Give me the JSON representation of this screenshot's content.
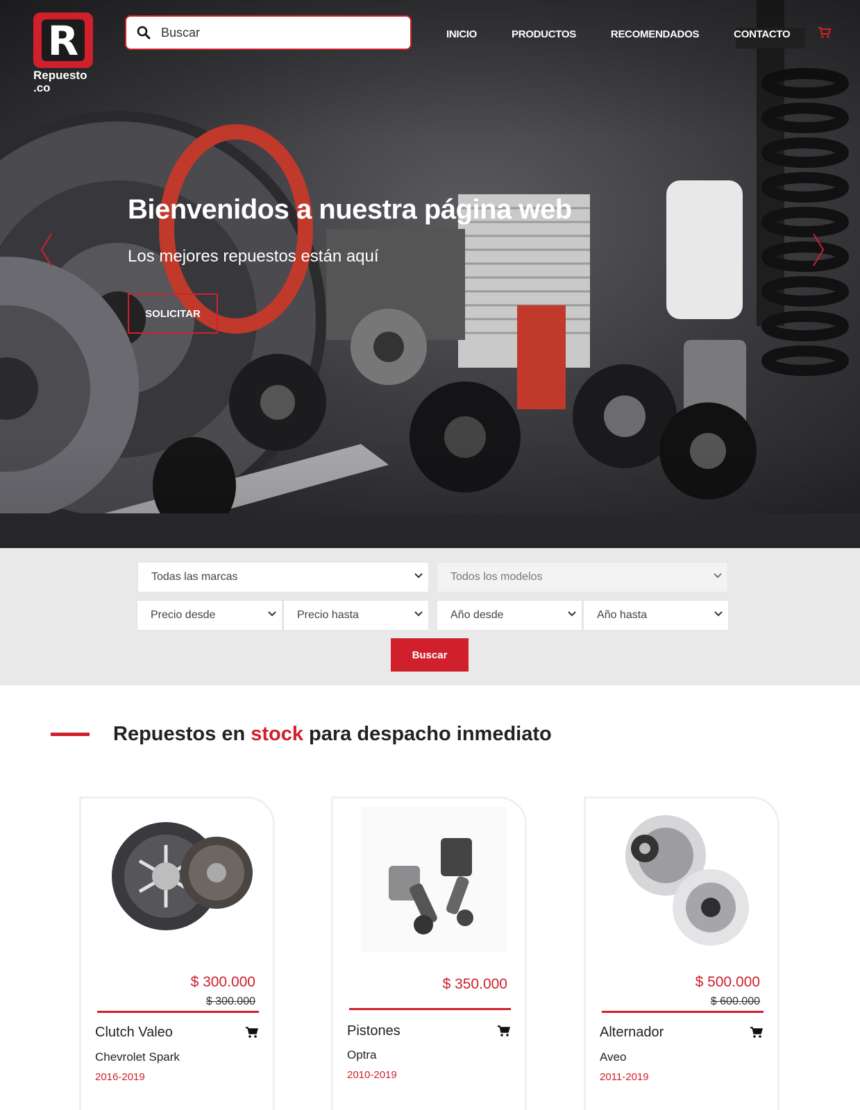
{
  "header": {
    "logo_letter": "R",
    "logo_brand_line1": "Repuesto",
    "logo_brand_line2": ".co",
    "search_placeholder": "Buscar",
    "nav": [
      "INICIO",
      "PRODUCTOS",
      "RECOMENDADOS",
      "CONTACTO"
    ],
    "cart_icon": "cart-icon"
  },
  "hero": {
    "title": "Bienvenidos a nuestra página web",
    "subtitle": "Los mejores repuestos están aquí",
    "button": "SOLICITAR",
    "prev_icon": "chevron-left-icon",
    "next_icon": "chevron-right-icon"
  },
  "filters": {
    "brand": "Todas las marcas",
    "model": "Todos los modelos",
    "price_from": "Precio desde",
    "price_to": "Precio hasta",
    "year_from": "Año desde",
    "year_to": "Año hasta",
    "search_button": "Buscar"
  },
  "section": {
    "title_before": "Repuestos en ",
    "title_highlight": "stock",
    "title_after": " para despacho inmediato"
  },
  "products": [
    {
      "name": "Clutch Valeo",
      "model": "Chevrolet Spark",
      "years": "2016-2019",
      "price": "$ 300.000",
      "old_price": "$ 300.000",
      "image": "clutch-image"
    },
    {
      "name": "Pistones",
      "model": "Optra",
      "years": "2010-2019",
      "price": "$ 350.000",
      "old_price": "",
      "image": "pistons-image"
    },
    {
      "name": "Alternador",
      "model": "Aveo",
      "years": "2011-2019",
      "price": "$ 500.000",
      "old_price": "$ 600.000",
      "image": "alternator-image"
    }
  ],
  "colors": {
    "accent": "#d0202c",
    "filter_bg": "#e9e9ea"
  }
}
